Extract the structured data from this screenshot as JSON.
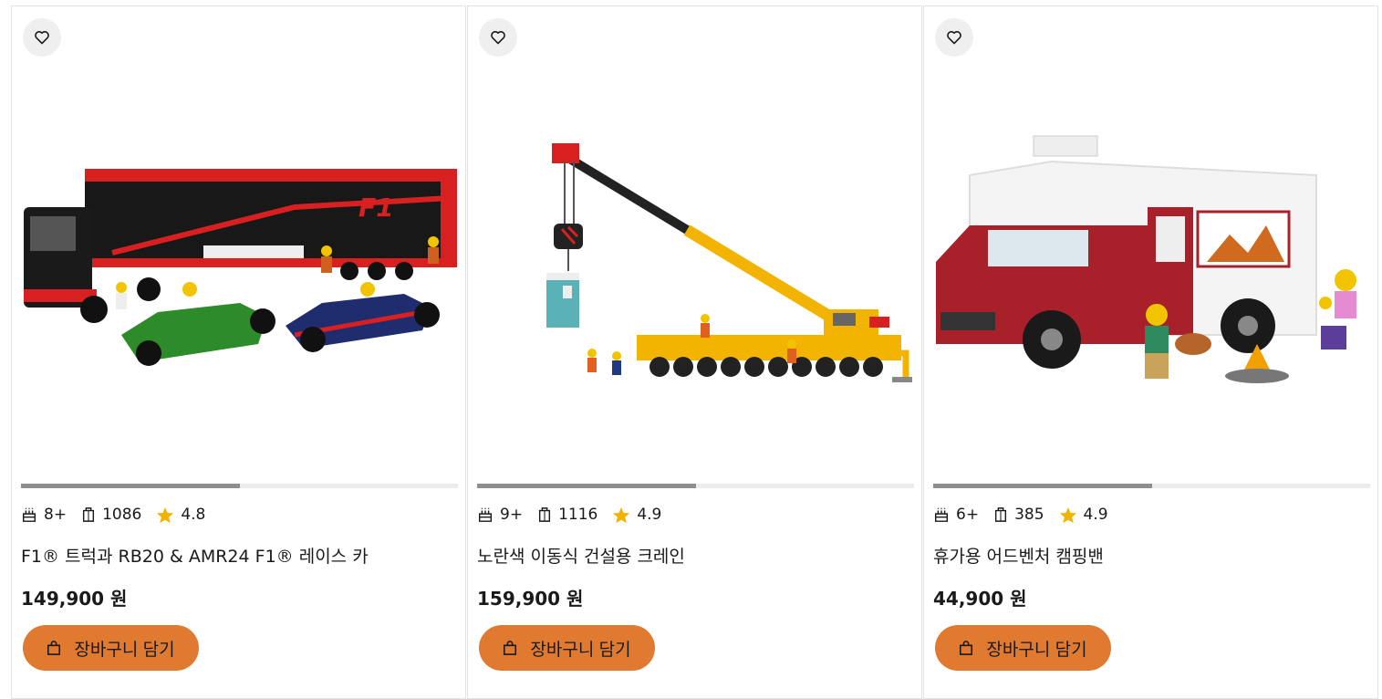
{
  "products": [
    {
      "age": "8+",
      "pieces": "1086",
      "rating": "4.8",
      "title": "F1® 트럭과 RB20 & AMR24 F1® 레이스 카",
      "price": "149,900 원",
      "cart_label": "장바구니 담기",
      "image_progress": 0.5
    },
    {
      "age": "9+",
      "pieces": "1116",
      "rating": "4.9",
      "title": "노란색 이동식 건설용 크레인",
      "price": "159,900 원",
      "cart_label": "장바구니 담기",
      "image_progress": 0.5
    },
    {
      "age": "6+",
      "pieces": "385",
      "rating": "4.9",
      "title": "휴가용 어드벤처 캠핑밴",
      "price": "44,900 원",
      "cart_label": "장바구니 담기",
      "image_progress": 0.5
    }
  ],
  "icons": {
    "wishlist": "heart-outline-icon",
    "age": "birthday-cake-icon",
    "pieces": "lego-brick-icon",
    "rating": "star-icon",
    "cart": "shopping-bag-icon"
  },
  "colors": {
    "cart_button": "#e07a31",
    "star": "#f0b400",
    "progress_fill": "#8e8e8e",
    "progress_track": "#ececec"
  }
}
